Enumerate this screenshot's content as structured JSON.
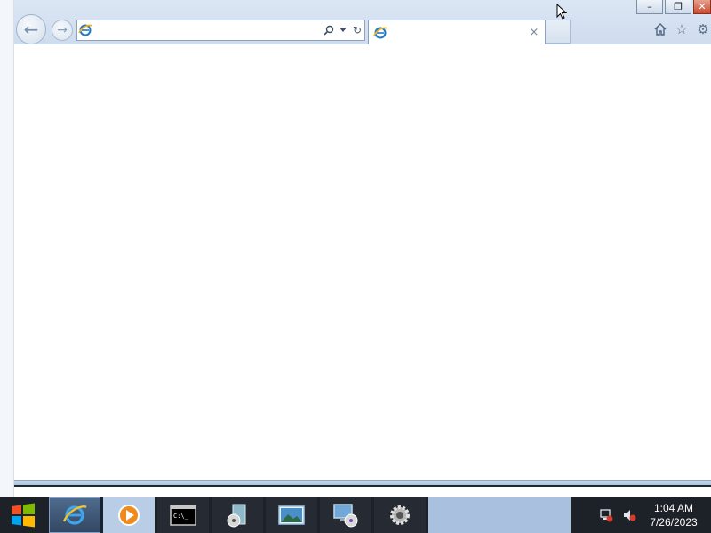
{
  "window": {
    "controls": {
      "minimize_icon": "minimize-icon",
      "restore_icon": "restore-icon",
      "close_icon": "close-icon"
    }
  },
  "navigation": {
    "back_icon": "back-arrow-icon",
    "forward_icon": "forward-arrow-icon"
  },
  "addressbar": {
    "value": "",
    "search_icon": "search-icon",
    "dropdown_icon": "chevron-down-icon",
    "refresh_icon": "refresh-icon"
  },
  "tab": {
    "title": "",
    "close_label": "×"
  },
  "toolbar": {
    "home_icon": "home-icon",
    "favorites_icon": "star-icon",
    "tools_icon": "gear-icon"
  },
  "taskbar": {
    "apps": [
      {
        "name": "internet-explorer",
        "active": true
      },
      {
        "name": "windows-media-player",
        "active": false
      },
      {
        "name": "command-prompt",
        "active": false
      },
      {
        "name": "install-disc",
        "active": false
      },
      {
        "name": "photo-viewer",
        "active": false
      },
      {
        "name": "computer-disc",
        "active": false
      },
      {
        "name": "settings-gear",
        "active": false
      }
    ]
  },
  "tray": {
    "network_icon": "network-icon",
    "volume_icon": "volume-muted-icon",
    "time": "1:04 AM",
    "date": "7/26/2023"
  },
  "colors": {
    "titlebar": "#d4e0ef",
    "taskbar": "#1d2128",
    "close_button": "#c94a30",
    "start_red": "#f25022",
    "start_green": "#7fba00",
    "start_blue": "#00a4ef",
    "start_yellow": "#ffb900"
  }
}
